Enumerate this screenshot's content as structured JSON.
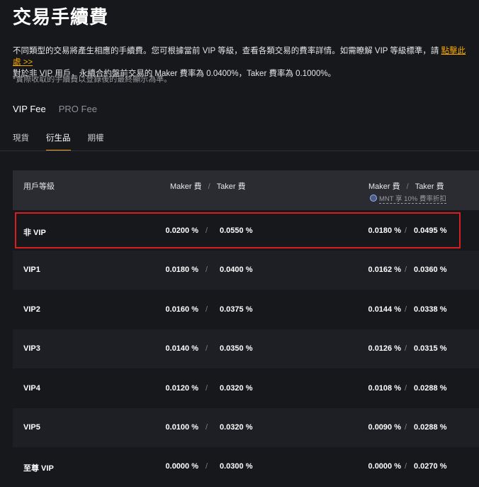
{
  "page": {
    "title": "交易手續費",
    "desc_line1": "不同類型的交易將產生相應的手續費。您可根據當前 VIP 等級，查看各類交易的費率詳情。如需瞭解 VIP 等級標準，請 ",
    "desc_link": "點擊此處 >>",
    "desc_line2": "對於非 VIP 用戶，永續合約盤前交易的 Maker 費率為 0.0400%，Taker 費率為 0.1000%。",
    "note": "*實際收取的手續費以登錄後的最終顯示為準。"
  },
  "fee_tabs": [
    "VIP Fee",
    "PRO Fee"
  ],
  "sub_tabs": [
    "現貨",
    "衍生品",
    "期權"
  ],
  "table": {
    "header_level": "用戶等級",
    "header_maker": "Maker 費",
    "header_taker": "Taker 費",
    "header_discount": "MNT 享 10% 費率折扣",
    "rows": [
      {
        "level": "非 VIP",
        "maker": "0.0200 %",
        "taker": "0.0550 %",
        "maker2": "0.0180 %",
        "taker2": "0.0495 %"
      },
      {
        "level": "VIP1",
        "maker": "0.0180 %",
        "taker": "0.0400 %",
        "maker2": "0.0162 %",
        "taker2": "0.0360 %"
      },
      {
        "level": "VIP2",
        "maker": "0.0160 %",
        "taker": "0.0375 %",
        "maker2": "0.0144 %",
        "taker2": "0.0338 %"
      },
      {
        "level": "VIP3",
        "maker": "0.0140 %",
        "taker": "0.0350 %",
        "maker2": "0.0126 %",
        "taker2": "0.0315 %"
      },
      {
        "level": "VIP4",
        "maker": "0.0120 %",
        "taker": "0.0320 %",
        "maker2": "0.0108 %",
        "taker2": "0.0288 %"
      },
      {
        "level": "VIP5",
        "maker": "0.0100 %",
        "taker": "0.0320 %",
        "maker2": "0.0090 %",
        "taker2": "0.0288 %"
      },
      {
        "level": "至尊 VIP",
        "maker": "0.0000 %",
        "taker": "0.0300 %",
        "maker2": "0.0000 %",
        "taker2": "0.0270 %"
      }
    ],
    "slash": "/"
  },
  "colors": {
    "accent": "#f7a600",
    "highlight": "#d81e1e",
    "background": "#17181c"
  }
}
